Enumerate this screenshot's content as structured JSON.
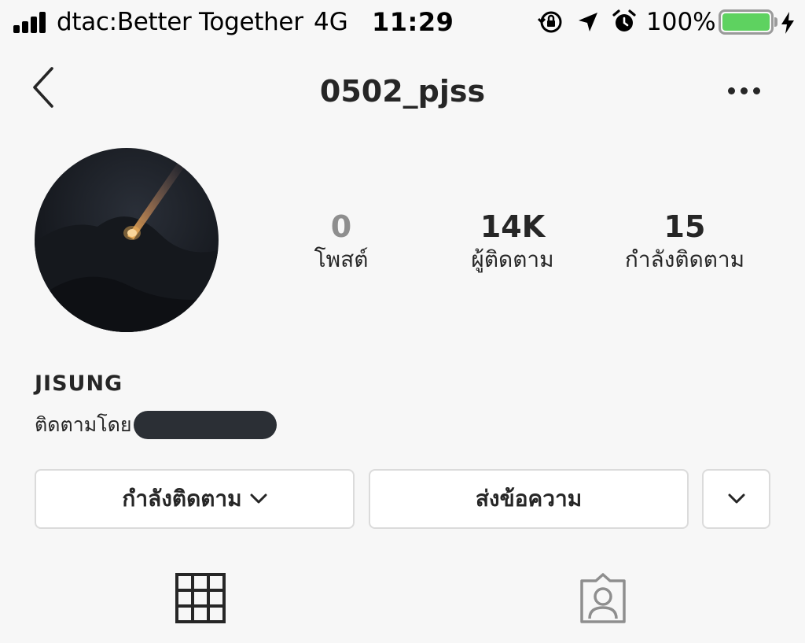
{
  "status_bar": {
    "carrier": "dtac:Better Together",
    "network": "4G",
    "time": "11:29",
    "battery_percent": "100%",
    "battery_level": 1.0,
    "icons": [
      "orientation-lock-icon",
      "location-arrow-icon",
      "alarm-icon",
      "battery-icon",
      "charging-icon"
    ]
  },
  "header": {
    "username": "0502_pjss",
    "back_icon": "chevron-left-icon",
    "more_icon": "more-horizontal-icon"
  },
  "profile": {
    "stats": {
      "posts": {
        "value": "0",
        "label": "โพสต์"
      },
      "followers": {
        "value": "14K",
        "label": "ผู้ติดตาม"
      },
      "following": {
        "value": "15",
        "label": "กำลังติดตาม"
      }
    },
    "display_name": "JISUNG",
    "followed_by_label": "ติดตามโดย"
  },
  "actions": {
    "following_label": "กำลังติดตาม",
    "message_label": "ส่งข้อความ",
    "suggest_icon": "chevron-down-icon"
  },
  "tabs": [
    {
      "icon": "grid-icon",
      "active": true
    },
    {
      "icon": "tagged-person-icon",
      "active": false
    }
  ],
  "colors": {
    "background": "#f7f7f7",
    "text": "#262626",
    "muted": "#8e8e8e",
    "border": "#dbdbdb",
    "battery_green": "#5ed260"
  }
}
